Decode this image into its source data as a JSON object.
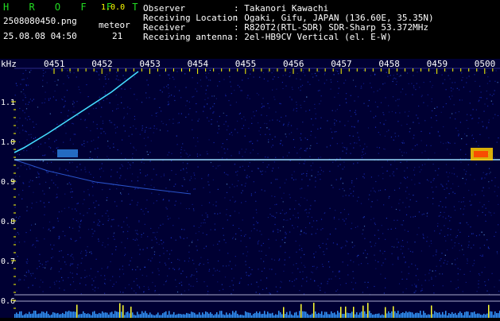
{
  "app": {
    "name": "H R O F F T",
    "version": "1.0.0"
  },
  "file": {
    "name": "2508080450.png",
    "datetime": "25.08.08 04:50"
  },
  "meteor": {
    "label": "meteor",
    "count": "21"
  },
  "info": [
    {
      "key": "Observer",
      "value": ": Takanori Kawachi"
    },
    {
      "key": "Receiving Location",
      "value": ": Ogaki, Gifu, JAPAN (136.60E, 35.35N)"
    },
    {
      "key": "Receiver",
      "value": ": R820T2(RTL-SDR) SDR-Sharp 53.372MHz"
    },
    {
      "key": "Receiving antenna",
      "value": ": 2el-HB9CV Vertical (el. E-W)"
    }
  ],
  "spectrogram": {
    "y_unit": "kHz",
    "y_ticks": [
      "1.1",
      "1.0",
      "0.9",
      "0.8",
      "0.7",
      "0.6"
    ],
    "x_ticks": [
      "0451",
      "0452",
      "0453",
      "0454",
      "0455",
      "0456",
      "0457",
      "0458",
      "0459",
      "0500"
    ],
    "colors": {
      "background": "#000033",
      "noise": "#1a2fcc",
      "signal": "#33ccff",
      "baseline": "#99ddff",
      "tick": "#ffff00",
      "label": "#ffffff"
    }
  }
}
